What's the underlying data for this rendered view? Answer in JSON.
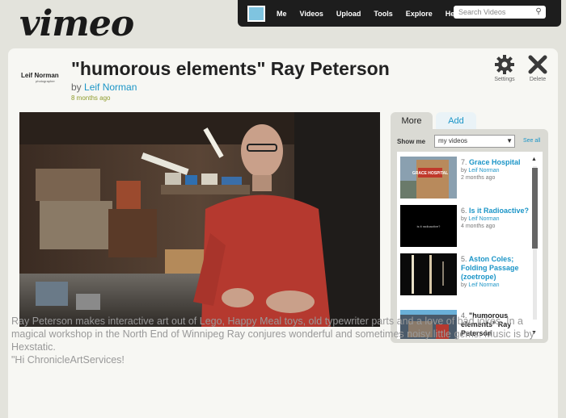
{
  "header": {
    "logo_text": "vimeo",
    "nav": {
      "items": [
        "Me",
        "Videos",
        "Upload",
        "Tools",
        "Explore",
        "Help"
      ],
      "search_placeholder": "Search Videos"
    }
  },
  "video": {
    "owner_logo": "Leif Norman",
    "owner_logo_sub": "photographer",
    "title": "\"humorous elements\" Ray Peterson",
    "by_prefix": "by",
    "author": "Leif Norman",
    "posted": "8 months ago",
    "actions": {
      "settings_label": "Settings",
      "delete_label": "Delete"
    },
    "description": [
      "Ray Peterson makes interactive art out of Lego, Happy Meal toys, old typewriter parts and a love of bad jokes. In a magical workshop in the North End of Winnipeg Ray conjures wonderful and sometimes noisy little gems. Music is by Hexstatic.",
      "\"Hi ChronicleArtServices!"
    ]
  },
  "sidebar": {
    "tabs": {
      "more": "More",
      "add": "Add"
    },
    "show_me_label": "Show me",
    "show_me_value": "my videos",
    "see_all": "See all",
    "videos": [
      {
        "num": "7.",
        "title": "Grace Hospital",
        "by": "by",
        "author": "Leif Norman",
        "date": "2 months ago"
      },
      {
        "num": "6.",
        "title": "Is it Radioactive?",
        "by": "by",
        "author": "Leif Norman",
        "date": "4 months ago"
      },
      {
        "num": "5.",
        "title": "Aston Coles; Folding Passage (zoetrope)",
        "by": "by",
        "author": "Leif Norman",
        "date": ""
      },
      {
        "num": "4.",
        "title": "\"humorous elements\" Ray Peterson",
        "by": "",
        "author": "",
        "date": ""
      }
    ],
    "thumb_text": {
      "grace": "GRACE HOSPITAL",
      "radio": "is it radioactive?"
    }
  }
}
